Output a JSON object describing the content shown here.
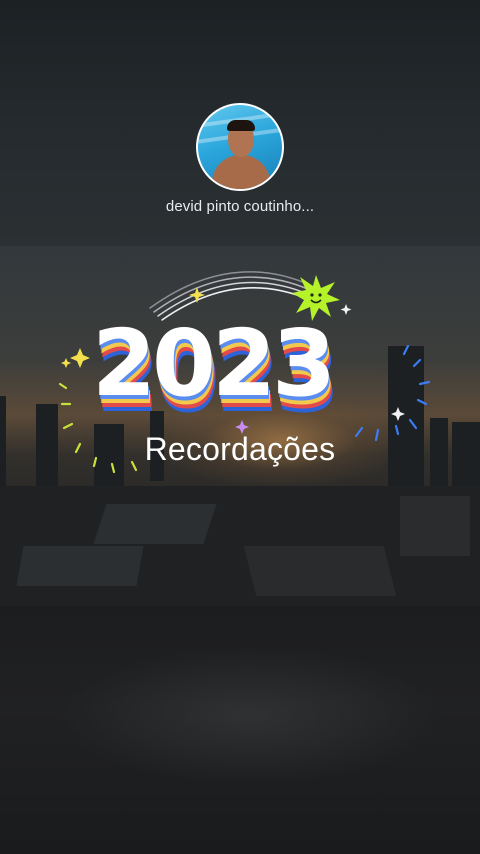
{
  "profile": {
    "username": "devid pinto coutinho..."
  },
  "card": {
    "year": "2023",
    "subtitle": "Recordações"
  },
  "colors": {
    "year_fill": "#ffffff",
    "stripe_blue": "#2d63d8",
    "stripe_red": "#e34b4b",
    "stripe_yellow": "#f2c94c",
    "sun_green": "#b6f22a"
  },
  "icons": [
    "avatar-photo",
    "smiling-sun-icon",
    "sparkle-icon",
    "firework-burst-icon",
    "rainbow-arc"
  ]
}
